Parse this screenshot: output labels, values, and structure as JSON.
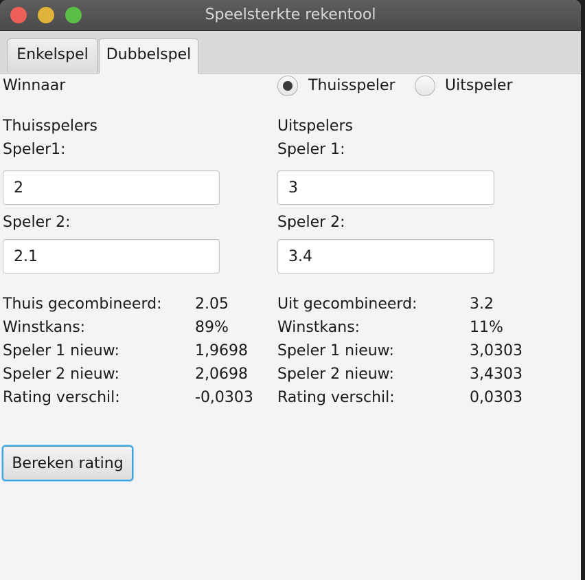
{
  "window": {
    "title": "Speelsterkte rekentool"
  },
  "tabs": [
    {
      "label": "Enkelspel",
      "selected": false
    },
    {
      "label": "Dubbelspel",
      "selected": true
    }
  ],
  "winner": {
    "label": "Winnaar",
    "options": [
      {
        "label": "Thuisspeler",
        "selected": true
      },
      {
        "label": "Uitspeler",
        "selected": false
      }
    ]
  },
  "home": {
    "heading": "Thuisspelers",
    "player1_label": "Speler1:",
    "player1_value": "2",
    "player2_label": "Speler 2:",
    "player2_value": "2.1"
  },
  "away": {
    "heading": "Uitspelers",
    "player1_label": "Speler 1:",
    "player1_value": "3",
    "player2_label": "Speler 2:",
    "player2_value": "3.4"
  },
  "results_home": [
    {
      "label": "Thuis gecombineerd:",
      "value": "2.05"
    },
    {
      "label": "Winstkans:",
      "value": "89%"
    },
    {
      "label": "Speler 1 nieuw:",
      "value": "1,9698"
    },
    {
      "label": "Speler 2 nieuw:",
      "value": "2,0698"
    },
    {
      "label": "Rating verschil:",
      "value": "-0,0303"
    }
  ],
  "results_away": [
    {
      "label": "Uit gecombineerd:",
      "value": "3.2"
    },
    {
      "label": "Winstkans:",
      "value": "11%"
    },
    {
      "label": "Speler 1 nieuw:",
      "value": "3,0303"
    },
    {
      "label": "Speler 2 nieuw:",
      "value": "3,4303"
    },
    {
      "label": "Rating verschil:",
      "value": "0,0303"
    }
  ],
  "calculate_button": "Bereken rating",
  "colors": {
    "titlebar": "#4f4f4f",
    "background": "#f4f4f4",
    "focus_ring": "#3aa3dd",
    "close": "#ed5f58",
    "minimize": "#e0b33b",
    "zoom": "#5bbe47"
  }
}
